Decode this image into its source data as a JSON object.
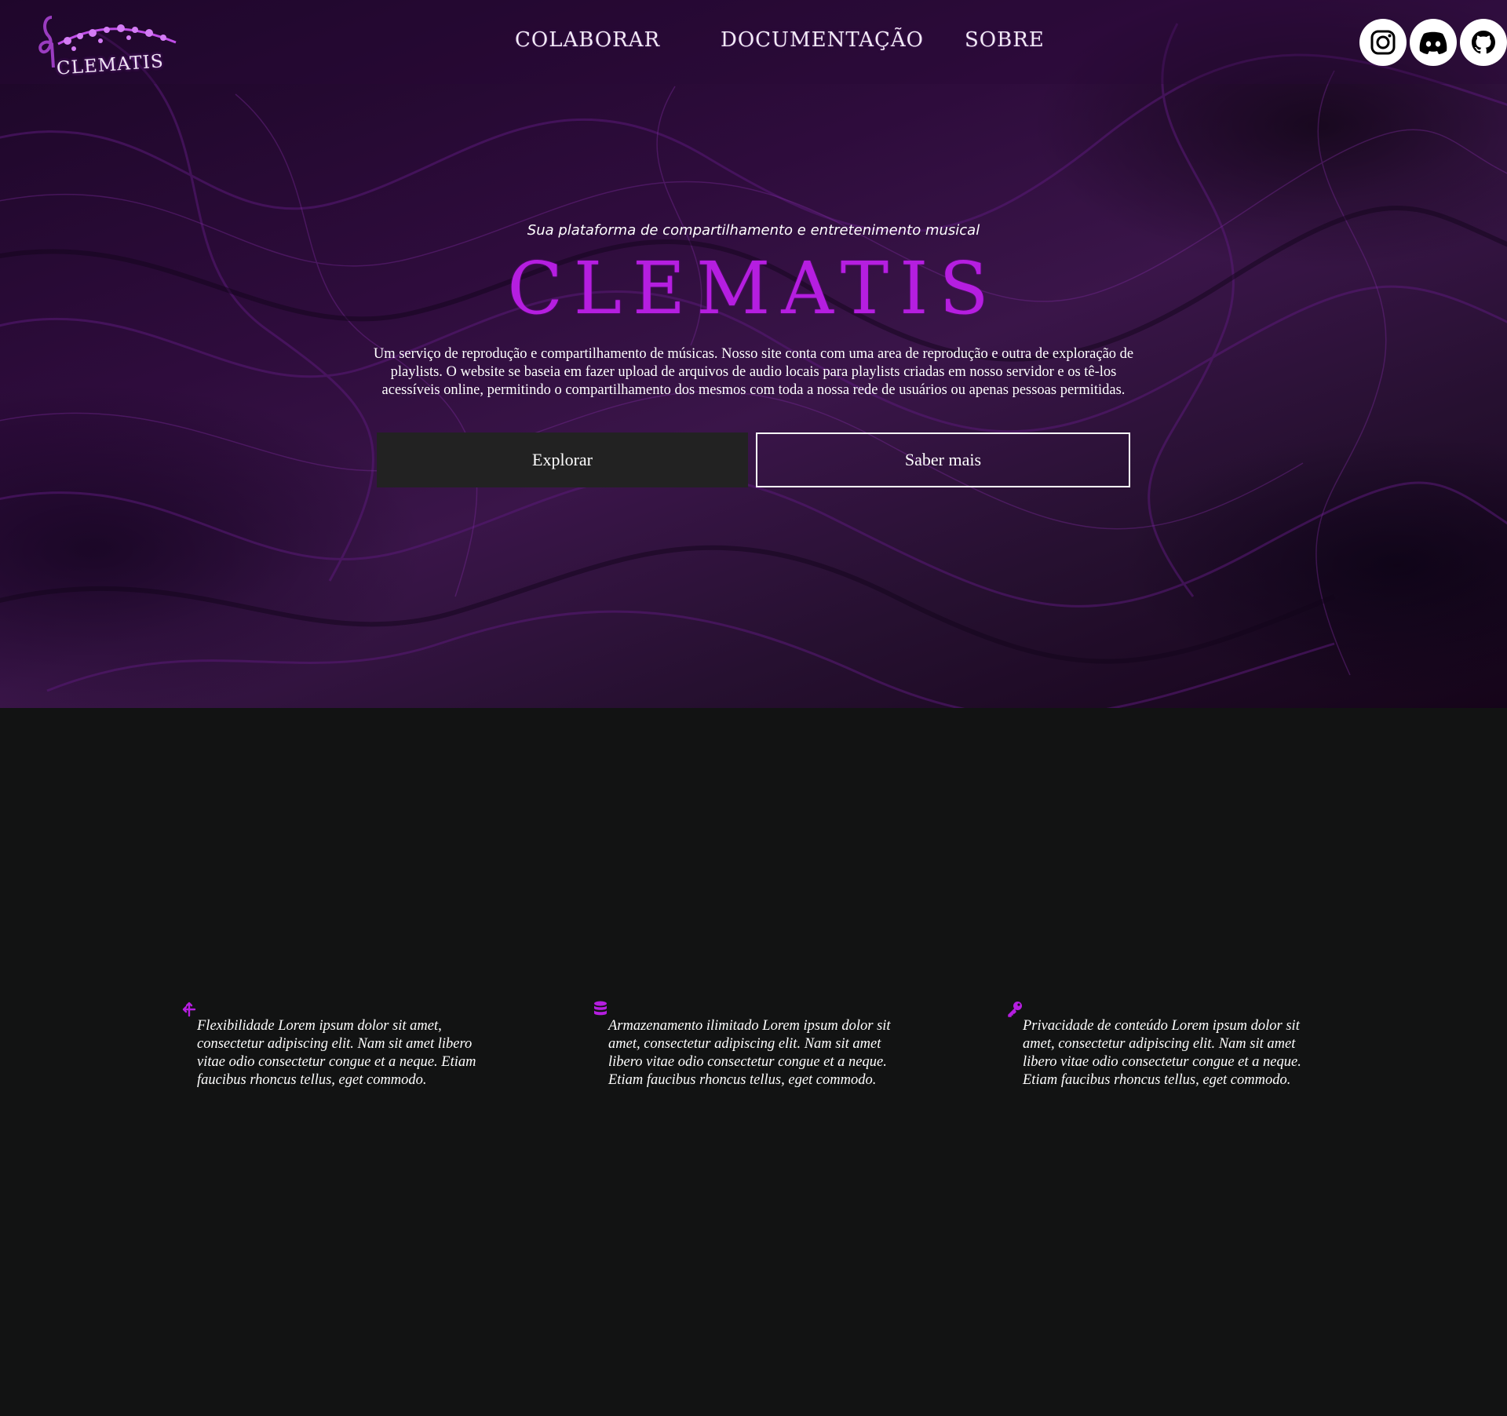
{
  "brand_color": "#b51ee0",
  "nav": {
    "logo_text": "CLEMATIS",
    "links": [
      "COLABORAR",
      "DOCUMENTAÇÃO",
      "SOBRE"
    ],
    "social_icons": [
      "instagram-icon",
      "discord-icon",
      "github-icon"
    ]
  },
  "hero": {
    "tagline": "Sua plataforma de compartilhamento e entretenimento musical",
    "title": "CLEMATIS",
    "description": "Um serviço de reprodução e compartilhamento de músicas. Nosso site conta com uma area de reprodução e outra de exploração de playlists. O website se baseia em fazer upload de arquivos de audio locais para playlists criadas em nosso servidor e os tê-los acessíveis online, permitindo o compartilhamento dos mesmos com toda a nossa rede de usuários ou apenas pessoas permitidas.",
    "explore_label": "Explorar",
    "more_label": "Saber mais"
  },
  "features": [
    {
      "icon": "fork-arrows-icon",
      "text": "Flexibilidade Lorem ipsum dolor sit amet, consectetur adipiscing elit. Nam sit amet libero vitae odio consectetur congue et a neque. Etiam faucibus rhoncus tellus, eget commodo."
    },
    {
      "icon": "database-icon",
      "text": "Armazenamento ilimitado Lorem ipsum dolor sit amet, consectetur adipiscing elit. Nam sit amet libero vitae odio consectetur congue et a neque. Etiam faucibus rhoncus tellus, eget commodo."
    },
    {
      "icon": "key-icon",
      "text": "Privacidade de conteúdo Lorem ipsum dolor sit amet, consectetur adipiscing elit. Nam sit amet libero vitae odio consectetur congue et a neque. Etiam faucibus rhoncus tellus, eget commodo."
    }
  ]
}
